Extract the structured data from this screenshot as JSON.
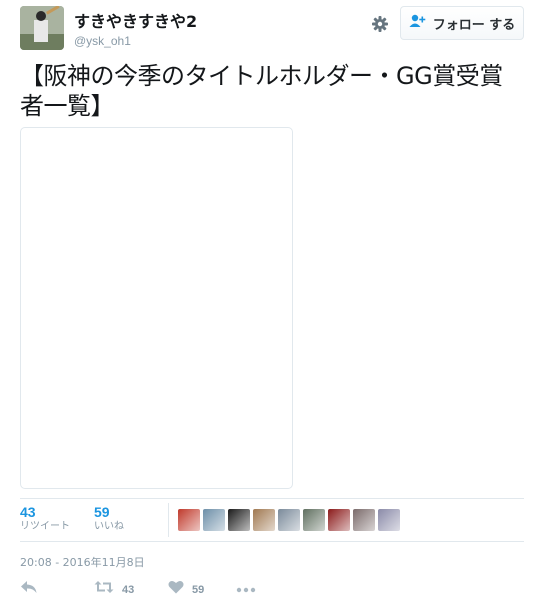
{
  "user": {
    "display_name": "すきやきすきや2",
    "screen_name": "@ysk_oh1"
  },
  "follow_button": {
    "label": "フォロー する"
  },
  "tweet": {
    "text": "【阪神の今季のタイトルホルダー・GG賞受賞者一覧】"
  },
  "stats": {
    "retweets": {
      "count": "43",
      "label": "リツイート"
    },
    "likes": {
      "count": "59",
      "label": "いいね"
    }
  },
  "liker_avatars": [
    {
      "color": "#c0392b"
    },
    {
      "color": "#6d8fa8"
    },
    {
      "color": "#1a1a1a"
    },
    {
      "color": "#a07850"
    },
    {
      "color": "#7a8a9a"
    },
    {
      "color": "#5f6f5f"
    },
    {
      "color": "#8b1a1a"
    },
    {
      "color": "#7a6a6a"
    },
    {
      "color": "#8a8aa8"
    }
  ],
  "timestamp": "20:08 - 2016年11月8日",
  "actions": {
    "retweet_count": "43",
    "like_count": "59"
  },
  "icons": {
    "gear": "gear-icon",
    "follow": "add-user-icon",
    "reply": "reply-icon",
    "retweet": "retweet-icon",
    "like": "heart-icon",
    "more": "more-icon"
  },
  "colors": {
    "accent": "#1b95e0",
    "muted": "#8899a6",
    "border": "#e1e8ed"
  }
}
